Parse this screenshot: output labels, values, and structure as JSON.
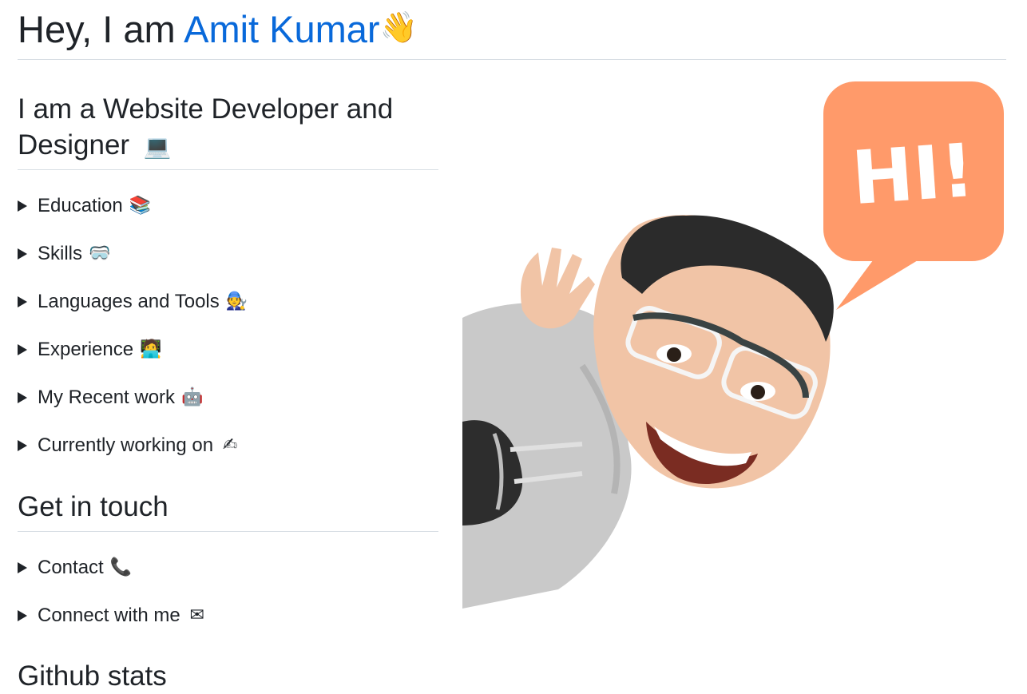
{
  "header": {
    "prefix": "Hey, I am ",
    "name": "Amit Kumar",
    "wave_icon": "waving-hand-icon",
    "wave_glyph": "👋"
  },
  "intro": {
    "heading": "I am a Website Developer and Designer",
    "icon": "laptop-icon",
    "glyph": "💻"
  },
  "sections": [
    {
      "label": "Education",
      "icon": "books-icon",
      "glyph": "📚"
    },
    {
      "label": "Skills",
      "icon": "goggles-icon",
      "glyph": "🥽"
    },
    {
      "label": "Languages and Tools",
      "icon": "mechanic-icon",
      "glyph": "🧑‍🔧"
    },
    {
      "label": "Experience",
      "icon": "technologist-icon",
      "glyph": "🧑‍💻"
    },
    {
      "label": "My Recent work",
      "icon": "robot-icon",
      "glyph": "🤖"
    },
    {
      "label": "Currently working on",
      "icon": "writing-hand-icon",
      "glyph": "✍"
    }
  ],
  "contact": {
    "heading": "Get in touch",
    "items": [
      {
        "label": "Contact",
        "icon": "telephone-icon",
        "glyph": "📞"
      },
      {
        "label": "Connect with me",
        "icon": "envelope-icon",
        "glyph": "✉"
      }
    ]
  },
  "stats": {
    "heading": "Github stats"
  },
  "illustration": {
    "bubble_text": "HI!",
    "colors": {
      "bubble": "#ff9a6a",
      "hoodie": "#c9c9c9",
      "skin": "#f1c4a6",
      "hair": "#2b2b2b"
    }
  },
  "colors": {
    "accent": "#0969da",
    "text": "#1f2328",
    "rule": "#d8dee4"
  }
}
